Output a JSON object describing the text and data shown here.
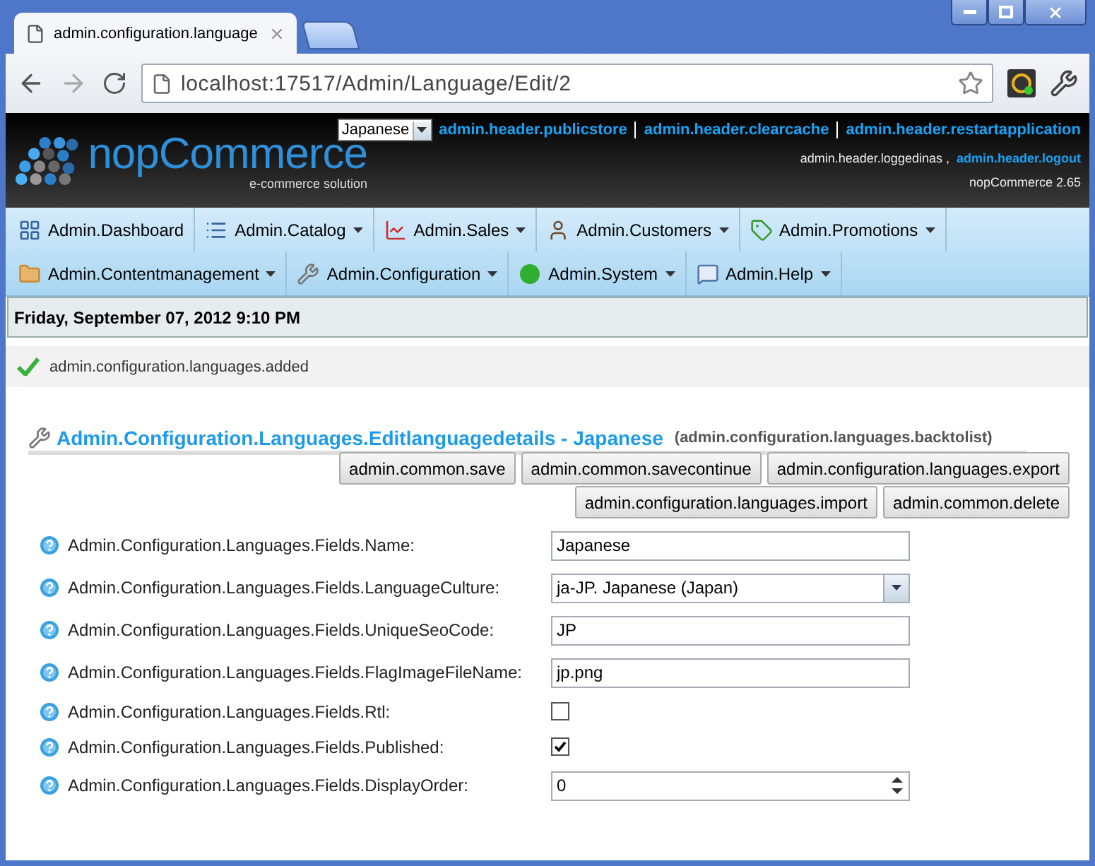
{
  "browser": {
    "tab_title": "admin.configuration.language",
    "address": "localhost:17517/Admin/Language/Edit/2"
  },
  "header": {
    "logo_text": "nopCommerce",
    "tagline": "e-commerce solution",
    "language_select": "Japanese",
    "links": [
      "admin.header.publicstore",
      "admin.header.clearcache",
      "admin.header.restartapplication"
    ],
    "logged_in_as": "admin.header.loggedinas ,",
    "logout": "admin.header.logout",
    "version": "nopCommerce 2.65"
  },
  "menu": [
    [
      {
        "label": "Admin.Dashboard",
        "dropdown": false
      },
      {
        "label": "Admin.Catalog",
        "dropdown": true
      },
      {
        "label": "Admin.Sales",
        "dropdown": true
      },
      {
        "label": "Admin.Customers",
        "dropdown": true
      },
      {
        "label": "Admin.Promotions",
        "dropdown": true
      }
    ],
    [
      {
        "label": "Admin.Contentmanagement",
        "dropdown": true
      },
      {
        "label": "Admin.Configuration",
        "dropdown": true
      },
      {
        "label": "Admin.System",
        "dropdown": true
      },
      {
        "label": "Admin.Help",
        "dropdown": true
      }
    ]
  ],
  "date": "Friday, September 07, 2012 9:10 PM",
  "message": "admin.configuration.languages.added",
  "page": {
    "title": "Admin.Configuration.Languages.Editlanguagedetails - Japanese",
    "back_link": "(admin.configuration.languages.backtolist)"
  },
  "buttons": [
    [
      "admin.common.save",
      "admin.common.savecontinue",
      "admin.configuration.languages.export"
    ],
    [
      "admin.configuration.languages.import",
      "admin.common.delete"
    ]
  ],
  "fields": [
    {
      "kind": "text",
      "label": "Admin.Configuration.Languages.Fields.Name:",
      "value": "Japanese"
    },
    {
      "kind": "select",
      "label": "Admin.Configuration.Languages.Fields.LanguageCulture:",
      "value": "ja-JP. Japanese (Japan)"
    },
    {
      "kind": "text",
      "label": "Admin.Configuration.Languages.Fields.UniqueSeoCode:",
      "value": "JP"
    },
    {
      "kind": "text",
      "label": "Admin.Configuration.Languages.Fields.FlagImageFileName:",
      "value": "jp.png"
    },
    {
      "kind": "checkbox",
      "label": "Admin.Configuration.Languages.Fields.Rtl:",
      "checked": false
    },
    {
      "kind": "checkbox",
      "label": "Admin.Configuration.Languages.Fields.Published:",
      "checked": true
    },
    {
      "kind": "number",
      "label": "Admin.Configuration.Languages.Fields.DisplayOrder:",
      "value": "0"
    }
  ]
}
